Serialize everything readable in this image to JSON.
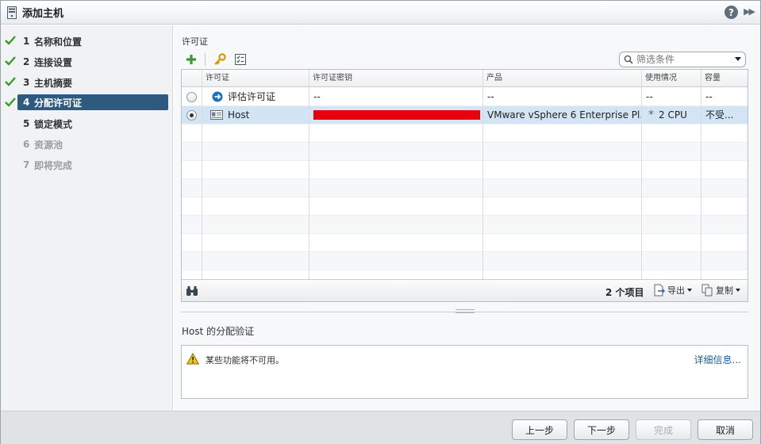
{
  "window": {
    "title": "添加主机",
    "help": "?"
  },
  "steps": [
    {
      "num": "1",
      "label": "名称和位置",
      "state": "done"
    },
    {
      "num": "2",
      "label": "连接设置",
      "state": "done"
    },
    {
      "num": "3",
      "label": "主机摘要",
      "state": "done"
    },
    {
      "num": "4",
      "label": "分配许可证",
      "state": "active"
    },
    {
      "num": "5",
      "label": "锁定模式",
      "state": "pending"
    },
    {
      "num": "6",
      "label": "资源池",
      "state": "disabled"
    },
    {
      "num": "7",
      "label": "即将完成",
      "state": "disabled"
    }
  ],
  "licenses": {
    "section_label": "许可证",
    "filter_placeholder": "筛选条件",
    "columns": [
      "许可证",
      "许可证密钥",
      "产品",
      "使用情况",
      "容量"
    ],
    "rows": [
      {
        "selected": false,
        "icon": "arrow-circle-icon",
        "license": "评估许可证",
        "key": "--",
        "product": "--",
        "usage": "--",
        "capacity": "--"
      },
      {
        "selected": true,
        "icon": "license-card-icon",
        "license": "Host",
        "key": "",
        "product": "VMware vSphere 6 Enterprise Pl...",
        "usage": "2 CPU",
        "capacity": "不受..."
      }
    ],
    "item_count": "2 个项目",
    "export_label": "导出",
    "copy_label": "复制"
  },
  "validation": {
    "title": "Host 的分配验证",
    "message": "某些功能将不可用。",
    "details_link": "详细信息..."
  },
  "buttons": {
    "back": "上一步",
    "next": "下一步",
    "finish": "完成",
    "cancel": "取消"
  },
  "colors": {
    "active_step": "#2d5a7e",
    "selected_row": "#d3e5f5",
    "check": "#3a9a2c",
    "redaction": "#e8000d",
    "link": "#1d5e9b"
  }
}
